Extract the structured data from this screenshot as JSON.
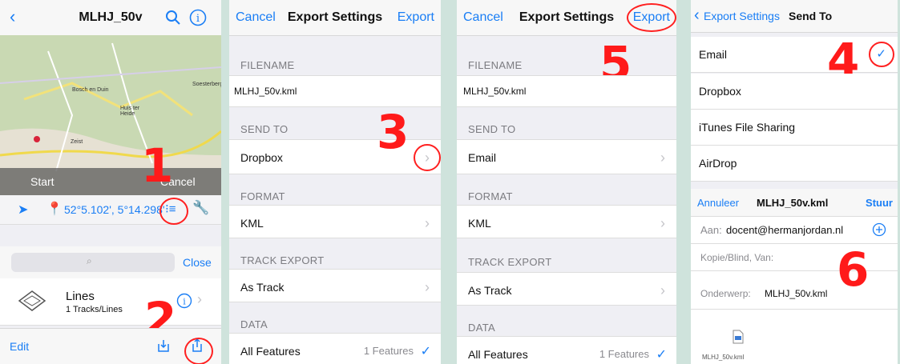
{
  "panel1": {
    "title": "MLHJ_50v",
    "back_icon": "chevron-left-icon",
    "map_labels": [
      "Bosch en Duin",
      "Soesterberg",
      "Huis ter Heide",
      "Zeist"
    ],
    "start_label": "Start",
    "cancel_label": "Cancel",
    "coordinates": "52°5.102', 5°14.298'",
    "search_placeholder": "",
    "close_label": "Close",
    "list_item_title": "Lines",
    "list_item_subtitle": "1 Tracks/Lines",
    "edit_label": "Edit",
    "step_1": "1",
    "step_2": "2"
  },
  "panel2": {
    "cancel": "Cancel",
    "title": "Export Settings",
    "export": "Export",
    "filename_header": "FILENAME",
    "filename_value": "MLHJ_50v.kml",
    "send_to_header": "SEND TO",
    "send_to_value": "Dropbox",
    "format_header": "FORMAT",
    "format_value": "KML",
    "track_export_header": "TRACK EXPORT",
    "track_export_value": "As Track",
    "data_header": "DATA",
    "data_value": "All Features",
    "data_count": "1 Features",
    "step_3": "3"
  },
  "panel3": {
    "cancel": "Cancel",
    "title": "Export Settings",
    "export": "Export",
    "filename_header": "FILENAME",
    "filename_value": "MLHJ_50v.kml",
    "send_to_header": "SEND TO",
    "send_to_value": "Email",
    "format_header": "FORMAT",
    "format_value": "KML",
    "track_export_header": "TRACK EXPORT",
    "track_export_value": "As Track",
    "data_header": "DATA",
    "data_value": "All Features",
    "data_count": "1 Features",
    "step_5": "5"
  },
  "panel4": {
    "back": "Export Settings",
    "title": "Send To",
    "options": [
      "Email",
      "Dropbox",
      "iTunes File Sharing",
      "AirDrop"
    ],
    "step_4": "4",
    "mail_cancel": "Annuleer",
    "mail_title": "MLHJ_50v.kml",
    "mail_send": "Stuur",
    "to_label": "Aan:",
    "to_value": "docent@hermanjordan.nl",
    "cc_label": "Kopie/Blind, Van:",
    "subject_label": "Onderwerp:",
    "subject_value": "MLHJ_50v.kml",
    "attachment_name": "MLHJ_50v.kml",
    "step_6": "6"
  },
  "colors": {
    "accent": "#1a7ef5",
    "annotation": "#ff1a1a",
    "background": "#cfe3dc"
  }
}
